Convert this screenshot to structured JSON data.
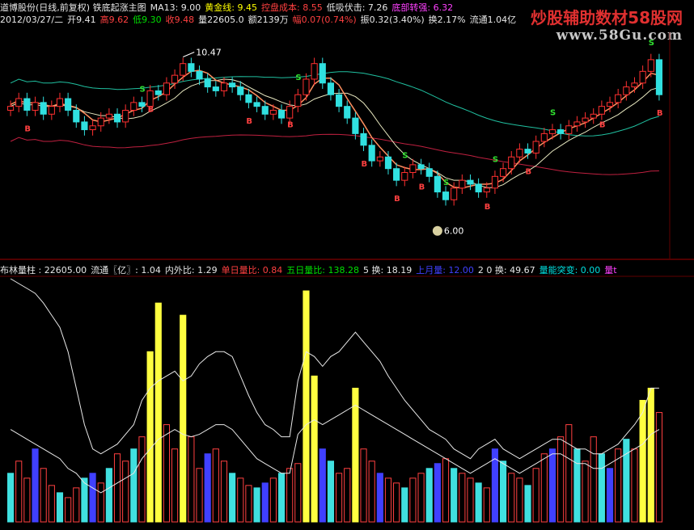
{
  "header1": [
    {
      "text": "道博股份(日线,前复权) 铁底起涨主图",
      "color": "#e8e8e8"
    },
    {
      "text": "MA13: 9.00",
      "color": "#e8e8e8"
    },
    {
      "text": "黄金线: 9.45",
      "color": "#ffff00"
    },
    {
      "text": "控盘成本: 8.55",
      "color": "#ff4040"
    },
    {
      "text": "低吸伏击: 7.26",
      "color": "#e8e8e8"
    },
    {
      "text": "底部转强: 6.32",
      "color": "#ff40ff"
    }
  ],
  "header2": [
    {
      "text": "2012/03/27/二",
      "color": "#e8e8e8"
    },
    {
      "text": "开9.41",
      "color": "#e8e8e8"
    },
    {
      "text": "高9.62",
      "color": "#ff4040"
    },
    {
      "text": "低9.30",
      "color": "#00e000"
    },
    {
      "text": "收9.48",
      "color": "#ff4040"
    },
    {
      "text": "量22605.0",
      "color": "#e8e8e8"
    },
    {
      "text": "额2139万",
      "color": "#e8e8e8"
    },
    {
      "text": "幅0.07(0.74%)",
      "color": "#ff4040"
    },
    {
      "text": "振0.32(3.40%)",
      "color": "#e8e8e8"
    },
    {
      "text": "换2.17%",
      "color": "#e8e8e8"
    },
    {
      "text": "流通1.04亿",
      "color": "#e8e8e8"
    }
  ],
  "header3": [
    {
      "text": "布林量柱 : 22605.00",
      "color": "#e8e8e8"
    },
    {
      "text": "流通〖亿〗: 1.04",
      "color": "#e8e8e8"
    },
    {
      "text": "内外比: 1.29",
      "color": "#e8e8e8"
    },
    {
      "text": "单日量比: 0.84",
      "color": "#ff4040"
    },
    {
      "text": "五日量比: 138.28",
      "color": "#00e000"
    },
    {
      "text": "5 换: 18.19",
      "color": "#e8e8e8"
    },
    {
      "text": "上月量: 12.00",
      "color": "#4040ff"
    },
    {
      "text": "2 0 换: 49.67",
      "color": "#e8e8e8"
    },
    {
      "text": "量能突变: 0.00",
      "color": "#00e0e0"
    },
    {
      "text": "量t",
      "color": "#ff40ff"
    }
  ],
  "watermark": {
    "line1": "炒股辅助数材58股网",
    "line2": "www.58Gu.com"
  },
  "annotations": {
    "high": "10.47",
    "low": "6.00"
  },
  "chart_data": [
    {
      "type": "candlestick",
      "title": "铁底起涨主图",
      "x_count": 80,
      "ylim": [
        5.6,
        11.0
      ],
      "closes": [
        9.2,
        9.4,
        9.1,
        9.3,
        9.0,
        9.2,
        9.4,
        9.1,
        8.8,
        8.6,
        8.7,
        8.9,
        9.0,
        8.8,
        9.1,
        9.3,
        9.2,
        9.6,
        9.5,
        9.8,
        10.0,
        10.3,
        10.1,
        9.9,
        9.7,
        9.6,
        9.8,
        9.7,
        9.5,
        9.3,
        9.2,
        9.0,
        9.1,
        8.9,
        9.2,
        9.5,
        9.9,
        10.3,
        9.8,
        9.5,
        9.2,
        8.9,
        8.5,
        8.2,
        7.8,
        7.9,
        7.6,
        7.3,
        7.5,
        7.7,
        7.6,
        7.4,
        7.0,
        6.8,
        7.1,
        7.3,
        7.2,
        7.0,
        7.1,
        7.4,
        7.6,
        7.9,
        8.1,
        8.0,
        8.3,
        8.5,
        8.6,
        8.5,
        8.7,
        8.8,
        8.9,
        9.0,
        9.2,
        9.3,
        9.5,
        9.7,
        9.8,
        10.1,
        10.4,
        9.5
      ],
      "high": 10.47,
      "low": 6.0,
      "buy_signals": [
        2,
        17,
        29,
        34,
        43,
        47,
        50,
        58,
        63,
        72,
        79
      ],
      "sell_signals": [
        16,
        35,
        48,
        53,
        59,
        66,
        78
      ]
    },
    {
      "type": "bar",
      "title": "布林量柱",
      "x_count": 80,
      "ylim": [
        0,
        100
      ],
      "values": [
        20,
        25,
        18,
        30,
        22,
        15,
        12,
        10,
        14,
        18,
        20,
        16,
        22,
        28,
        25,
        30,
        35,
        70,
        90,
        40,
        30,
        85,
        35,
        22,
        28,
        30,
        25,
        20,
        18,
        15,
        14,
        16,
        18,
        20,
        22,
        24,
        95,
        60,
        30,
        25,
        20,
        22,
        55,
        30,
        25,
        20,
        18,
        16,
        14,
        18,
        20,
        22,
        24,
        26,
        22,
        20,
        18,
        16,
        14,
        30,
        25,
        20,
        18,
        15,
        22,
        28,
        30,
        35,
        40,
        30,
        25,
        35,
        28,
        22,
        30,
        34,
        30,
        50,
        55,
        45
      ],
      "upper_band": [
        100,
        98,
        96,
        94,
        90,
        85,
        80,
        70,
        55,
        40,
        30,
        28,
        30,
        32,
        36,
        40,
        50,
        55,
        58,
        60,
        62,
        58,
        60,
        65,
        68,
        70,
        70,
        68,
        60,
        52,
        45,
        40,
        38,
        35,
        35,
        58,
        70,
        68,
        64,
        68,
        70,
        74,
        78,
        74,
        70,
        66,
        60,
        55,
        50,
        46,
        42,
        38,
        36,
        34,
        30,
        28,
        26,
        30,
        32,
        34,
        30,
        28,
        26,
        28,
        30,
        32,
        34,
        34,
        32,
        30,
        30,
        28,
        28,
        30,
        32,
        36,
        40,
        45,
        55,
        55
      ],
      "middle_band": [
        38,
        36,
        34,
        32,
        30,
        28,
        26,
        22,
        20,
        16,
        14,
        12,
        14,
        16,
        18,
        20,
        26,
        30,
        34,
        36,
        38,
        36,
        35,
        36,
        38,
        40,
        40,
        38,
        34,
        30,
        26,
        24,
        22,
        20,
        20,
        36,
        40,
        42,
        40,
        42,
        44,
        46,
        48,
        46,
        44,
        42,
        40,
        38,
        36,
        34,
        32,
        30,
        28,
        26,
        24,
        22,
        20,
        22,
        24,
        26,
        24,
        22,
        20,
        22,
        24,
        26,
        28,
        28,
        26,
        24,
        24,
        22,
        22,
        24,
        26,
        28,
        30,
        32,
        36,
        38
      ]
    }
  ]
}
